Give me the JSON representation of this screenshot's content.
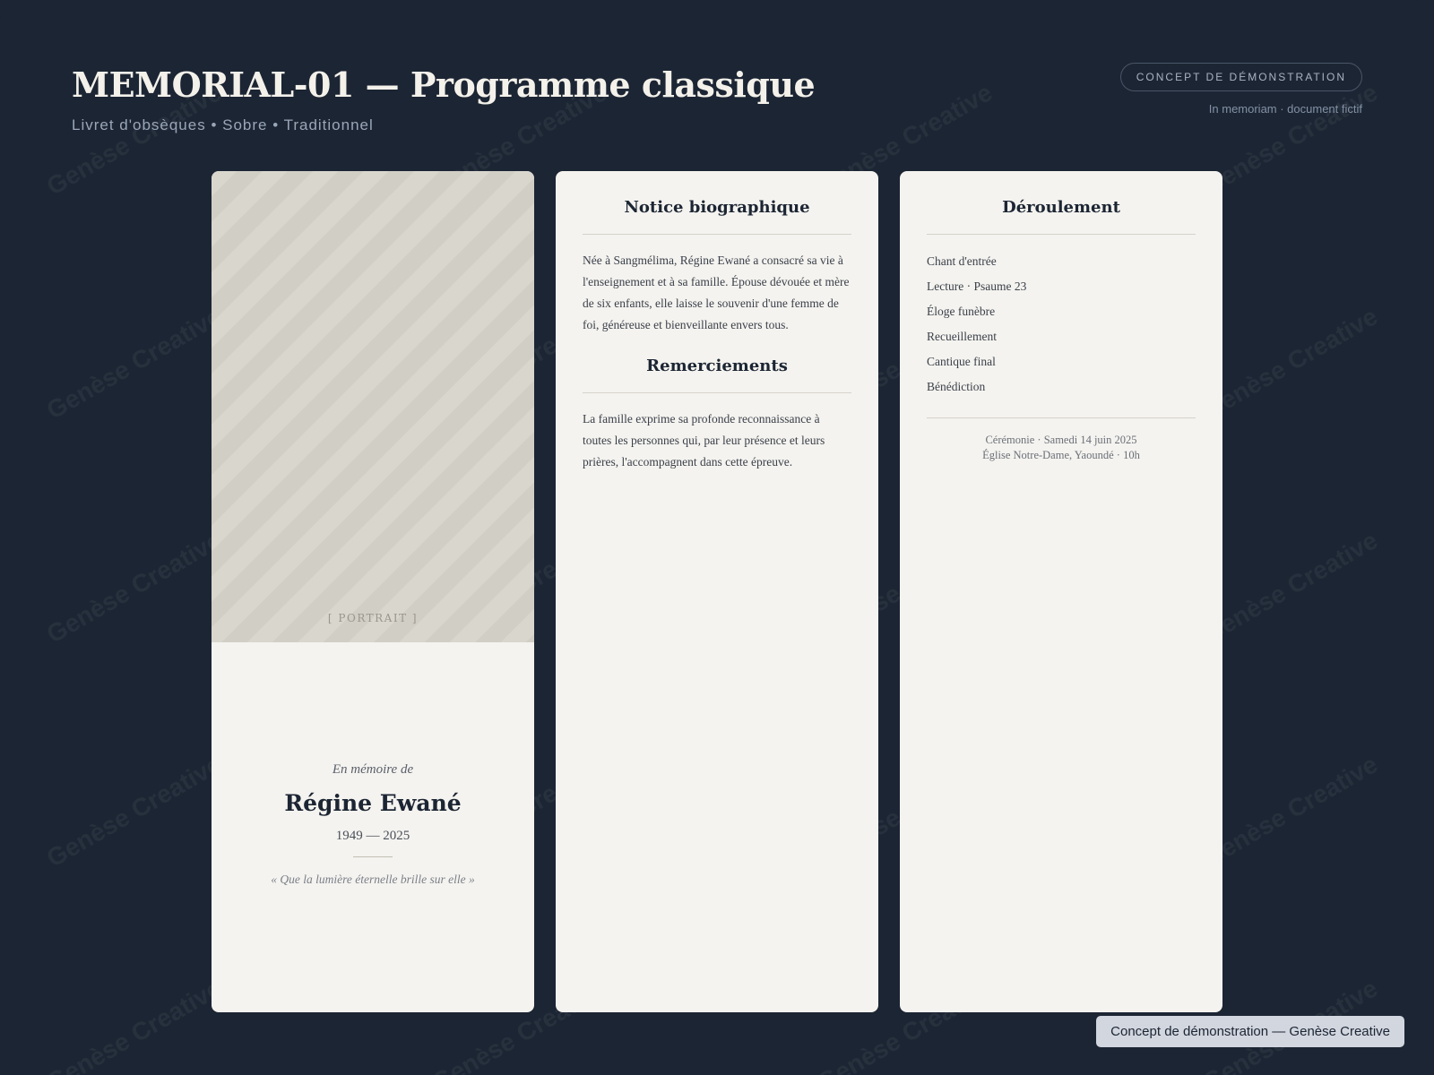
{
  "header": {
    "title": "MEMORIAL-01 — Programme classique",
    "subtitle": "Livret d'obsèques • Sobre • Traditionnel",
    "badge": "CONCEPT DE DÉMONSTRATION",
    "badge_note": "In memoriam · document fictif"
  },
  "watermark": "Genèse Creative",
  "cover": {
    "portrait_label": "[ PORTRAIT ]",
    "in_memory": "En mémoire de",
    "name": "Régine Ewané",
    "years": "1949 — 2025",
    "quote": "« Que la lumière éternelle brille sur elle »"
  },
  "biography": {
    "title": "Notice biographique",
    "text": "Née à Sangmélima, Régine Ewané a consacré sa vie à l'enseignement et à sa famille. Épouse dévouée et mère de six enfants, elle laisse le souvenir d'une femme de foi, généreuse et bienveillante envers tous."
  },
  "thanks": {
    "title": "Remerciements",
    "text": "La famille exprime sa profonde reconnaissance à toutes les personnes qui, par leur présence et leurs prières, l'accompagnent dans cette épreuve."
  },
  "order": {
    "title": "Déroulement",
    "items": [
      "Chant d'entrée",
      "Lecture · Psaume 23",
      "Éloge funèbre",
      "Recueillement",
      "Cantique final",
      "Bénédiction"
    ],
    "ceremony_line1": "Cérémonie · Samedi 14 juin 2025",
    "ceremony_line2": "Église Notre-Dame, Yaoundé · 10h"
  },
  "footer": {
    "label": "Concept de démonstration — Genèse Creative"
  }
}
